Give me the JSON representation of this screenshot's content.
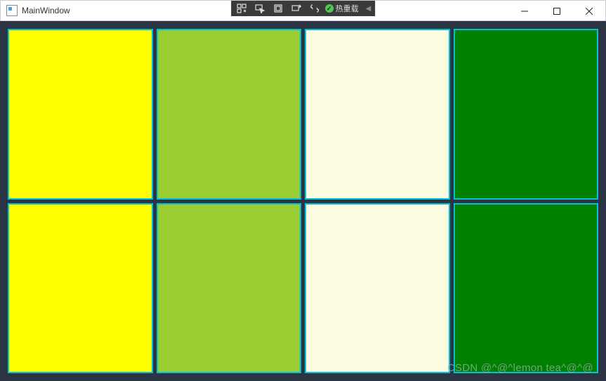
{
  "window": {
    "title": "MainWindow"
  },
  "debugToolbar": {
    "hotReloadLabel": "热重载"
  },
  "grid": {
    "borderColor": "#00c1d6",
    "cells": [
      {
        "color": "#ffff00"
      },
      {
        "color": "#9acd32"
      },
      {
        "color": "#fcfce0"
      },
      {
        "color": "#008000"
      },
      {
        "color": "#ffff00"
      },
      {
        "color": "#9acd32"
      },
      {
        "color": "#fcfce0"
      },
      {
        "color": "#008000"
      }
    ]
  },
  "watermark": {
    "text": "CSDN @^@^lemon tea^@^@"
  }
}
